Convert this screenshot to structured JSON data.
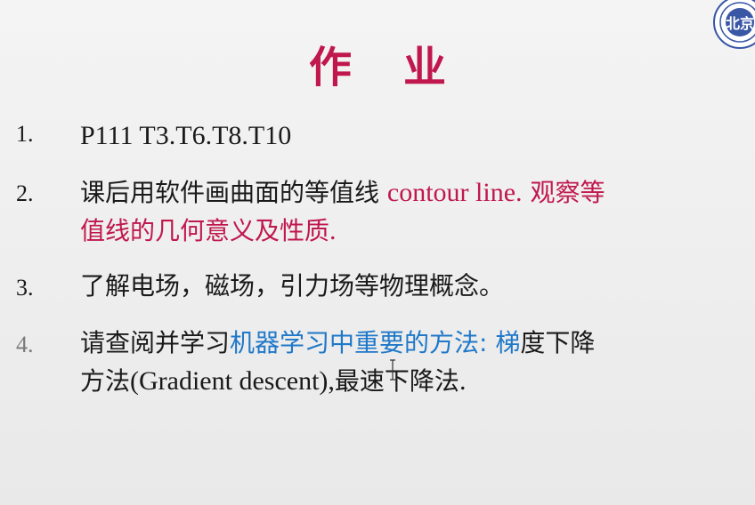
{
  "title": {
    "char1": "作",
    "char2": "业"
  },
  "logo": {
    "name": "university-seal-icon",
    "text": "北京"
  },
  "items": [
    {
      "number": "1.",
      "text": "P111    T3.T6.T8.T10"
    },
    {
      "number": "2.",
      "text_black": "课后用软件画曲面的等值线 ",
      "text_red_serif": "contour line.",
      "text_red_line1": " 观察等",
      "text_red_line2": "值线的几何意义及性质",
      "text_red_end": "."
    },
    {
      "number": "3.",
      "text": "了解电场，磁场，引力场等物理概念。"
    },
    {
      "number": "4.",
      "text_lead": "请查阅并学习",
      "text_blue": "机器学习中重要的方法: 梯",
      "text_after_blue": "度下降",
      "text_line2_a": "方法",
      "text_line2_serif": "(Gradient descent),",
      "text_line2_b": "最速下降法",
      "text_line2_end": "."
    }
  ],
  "colors": {
    "accent_red": "#c0184e",
    "accent_blue": "#1f78c8",
    "text_dark": "#1a1a1a",
    "number_gray": "#7a7a7a"
  }
}
